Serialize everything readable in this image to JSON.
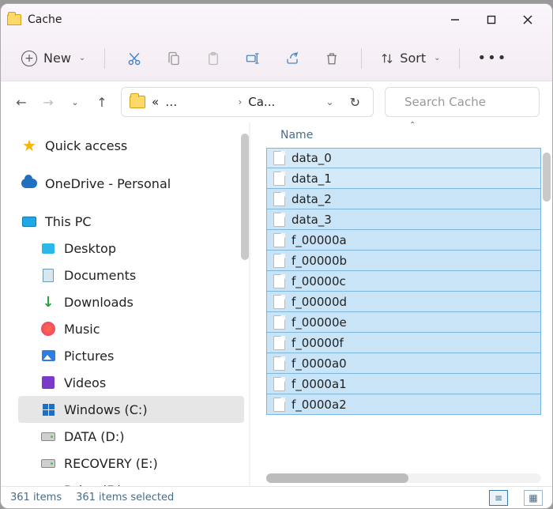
{
  "window": {
    "title": "Cache"
  },
  "toolbar": {
    "new": "New",
    "sort": "Sort"
  },
  "breadcrumb": {
    "ellipsis": "…",
    "current": "Ca..."
  },
  "search": {
    "placeholder": "Search Cache"
  },
  "nav": {
    "quick_access": "Quick access",
    "onedrive": "OneDrive - Personal",
    "this_pc": "This PC",
    "desktop": "Desktop",
    "documents": "Documents",
    "downloads": "Downloads",
    "music": "Music",
    "pictures": "Pictures",
    "videos": "Videos",
    "windows_c": "Windows (C:)",
    "data_d": "DATA (D:)",
    "recovery_e": "RECOVERY (E:)",
    "drive_f": "Drive (F:)"
  },
  "columns": {
    "name": "Name"
  },
  "files": [
    "data_0",
    "data_1",
    "data_2",
    "data_3",
    "f_00000a",
    "f_00000b",
    "f_00000c",
    "f_00000d",
    "f_00000e",
    "f_00000f",
    "f_0000a0",
    "f_0000a1",
    "f_0000a2"
  ],
  "status": {
    "count": "361 items",
    "selected": "361 items selected"
  }
}
